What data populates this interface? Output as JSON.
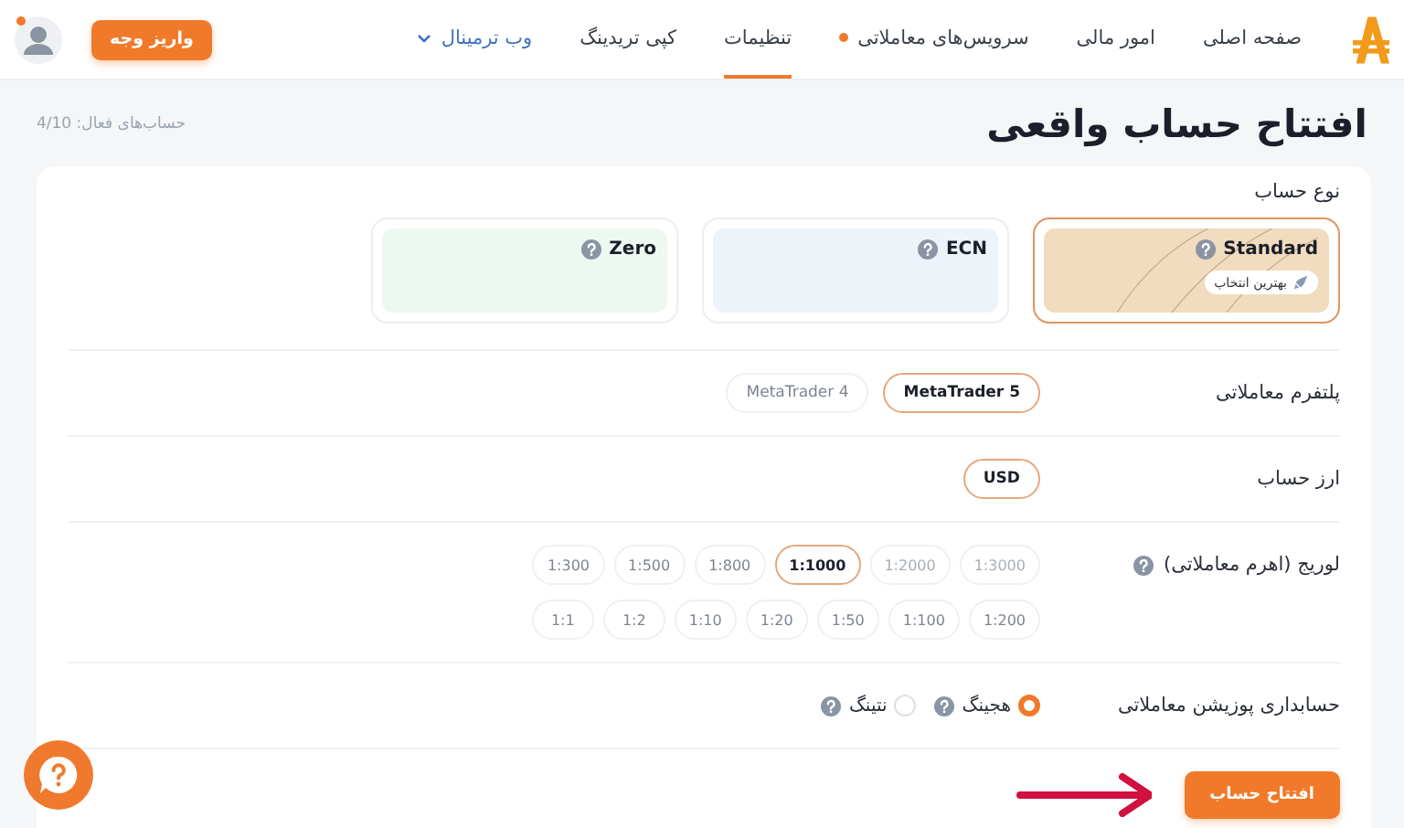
{
  "header": {
    "nav": [
      {
        "label": "صفحه اصلی",
        "selected": false,
        "dot": false,
        "kind": "link"
      },
      {
        "label": "امور مالی",
        "selected": false,
        "dot": false,
        "kind": "link"
      },
      {
        "label": "سرویس‌های معاملاتی",
        "selected": false,
        "dot": true,
        "kind": "link"
      },
      {
        "label": "تنظیمات",
        "selected": true,
        "dot": false,
        "kind": "link"
      },
      {
        "label": "کپی تریدینگ",
        "selected": false,
        "dot": false,
        "kind": "link"
      },
      {
        "label": "وب ترمینال",
        "selected": false,
        "dot": false,
        "kind": "dropdown"
      }
    ],
    "deposit_button": "واریز وجه",
    "avatar": {
      "notification": true
    }
  },
  "page": {
    "title": "افتتاح حساب واقعی",
    "active_accounts": "حساب‌های فعال: 4/10"
  },
  "account_type": {
    "label": "نوع حساب",
    "options": [
      {
        "name": "Standard",
        "selected": true,
        "help": true,
        "badge": "بهترین انتخاب",
        "color": "#f1dcbf"
      },
      {
        "name": "ECN",
        "selected": false,
        "help": true,
        "color": "#eef3fa"
      },
      {
        "name": "Zero",
        "selected": false,
        "help": true,
        "color": "#edf9f0"
      }
    ]
  },
  "platform": {
    "label": "پلتفرم معاملاتی",
    "options": [
      {
        "label": "MetaTrader 5",
        "selected": true,
        "disabled": false
      },
      {
        "label": "MetaTrader 4",
        "selected": false,
        "disabled": false
      }
    ]
  },
  "currency": {
    "label": "ارز حساب",
    "options": [
      {
        "label": "USD",
        "selected": true,
        "disabled": false
      }
    ]
  },
  "leverage": {
    "label": "لوریج (اهرم معاملاتی)",
    "help": true,
    "options": [
      {
        "label": "1:3000",
        "selected": false,
        "disabled": true
      },
      {
        "label": "1:2000",
        "selected": false,
        "disabled": true
      },
      {
        "label": "1:1000",
        "selected": true,
        "disabled": false
      },
      {
        "label": "1:800",
        "selected": false,
        "disabled": false
      },
      {
        "label": "1:500",
        "selected": false,
        "disabled": false
      },
      {
        "label": "1:300",
        "selected": false,
        "disabled": false
      },
      {
        "label": "1:200",
        "selected": false,
        "disabled": false
      },
      {
        "label": "1:100",
        "selected": false,
        "disabled": false
      },
      {
        "label": "1:50",
        "selected": false,
        "disabled": false
      },
      {
        "label": "1:20",
        "selected": false,
        "disabled": false
      },
      {
        "label": "1:10",
        "selected": false,
        "disabled": false
      },
      {
        "label": "1:2",
        "selected": false,
        "disabled": false
      },
      {
        "label": "1:1",
        "selected": false,
        "disabled": false
      }
    ]
  },
  "position_accounting": {
    "label": "حسابداری پوزیشن معاملاتی",
    "options": [
      {
        "label": "هجینگ",
        "selected": true,
        "help": true
      },
      {
        "label": "نتینگ",
        "selected": false,
        "help": true
      }
    ]
  },
  "submit_button": "افتتاح حساب"
}
